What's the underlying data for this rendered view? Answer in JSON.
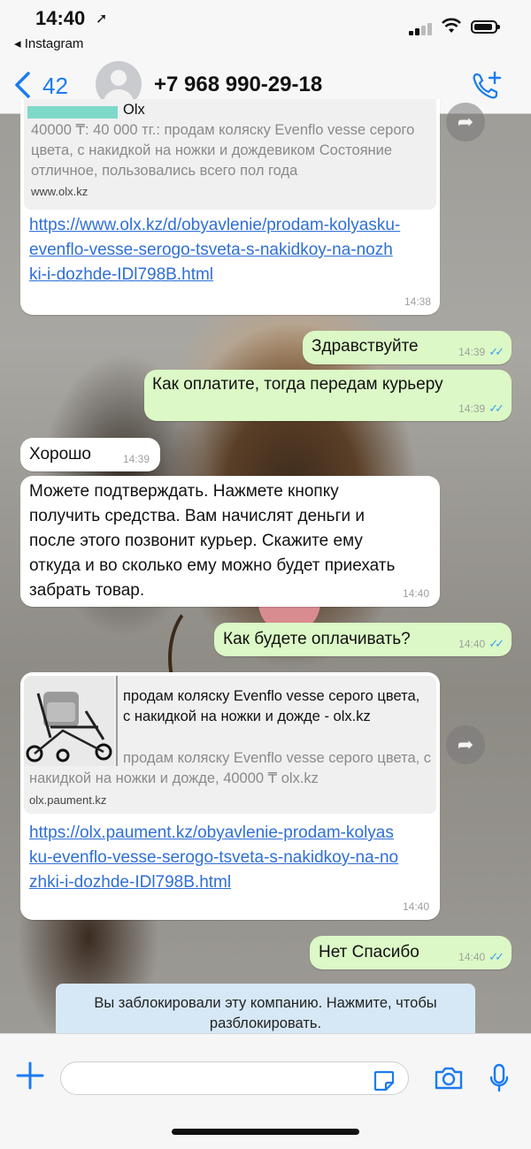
{
  "status_bar": {
    "time": "14:40",
    "back_app": "◂ Instagram"
  },
  "header": {
    "back_count": "42",
    "contact": "+7 968 990-29-18"
  },
  "messages": {
    "m1": {
      "preview_site": "Olx",
      "preview_desc": "40000 ₸: 40 000 тг.: продам коляску Evenflo vesse серого цвета, с накидкой на ножки и дождевиком Состояние отличное, пользовались всего пол года",
      "preview_domain": "www.olx.kz",
      "link": "https://www.olx.kz/d/obyavlenie/prodam-kolyasku-evenflo-vesse-serogo-tsveta-s-nakidkoy-na-nozhki-i-dozhde-IDl798B.html",
      "time": "14:38"
    },
    "m2": {
      "text": "Здравствуйте",
      "time": "14:39"
    },
    "m3": {
      "text": "Как оплатите, тогда передам курьеру",
      "time": "14:39"
    },
    "m4": {
      "text": "Хорошо",
      "time": "14:39"
    },
    "m5": {
      "text": "Можете подтверждать. Нажмете кнопку получить средства. Вам начислят деньги и после этого позвонит курьер. Скажите ему откуда и во сколько ему можно будет приехать забрать товар.",
      "time": "14:40"
    },
    "m6": {
      "text": "Как будете оплачивать?",
      "time": "14:40"
    },
    "m7": {
      "preview_title": "продам коляску Evenflo vesse серого цвета, с накидкой на ножки и дожде - olx.kz",
      "preview_desc": "продам коляску Evenflo vesse серого цвета, с накидкой на ножки и дожде, 40000 ₸ olx.kz",
      "preview_domain": "olx.paument.kz",
      "link": "https://olx.paument.kz/obyavlenie-prodam-kolyasku-evenflo-vesse-serogo-tsveta-s-nakidkoy-na-nozhki-i-dozhde-IDl798B.html",
      "time": "14:40"
    },
    "m8": {
      "text": "Нет Спасибо",
      "time": "14:40"
    }
  },
  "system_notice": "Вы заблокировали эту компанию. Нажмите, чтобы разблокировать.",
  "icons": {
    "location": "location-arrow-icon",
    "signal": "signal-icon",
    "wifi": "wifi-icon",
    "battery": "battery-icon",
    "back": "chevron-left-icon",
    "call": "add-call-icon",
    "forward": "forward-icon",
    "read": "double-check-icon",
    "plus": "plus-icon",
    "sticker": "sticker-icon",
    "camera": "camera-icon",
    "mic": "microphone-icon"
  },
  "colors": {
    "accent": "#1a7bf0",
    "outgoing": "#dcf8c6",
    "incoming": "#ffffff",
    "link": "#2f6fd6",
    "notice": "#d6e8f6",
    "read_ticks": "#3f9ef0"
  }
}
